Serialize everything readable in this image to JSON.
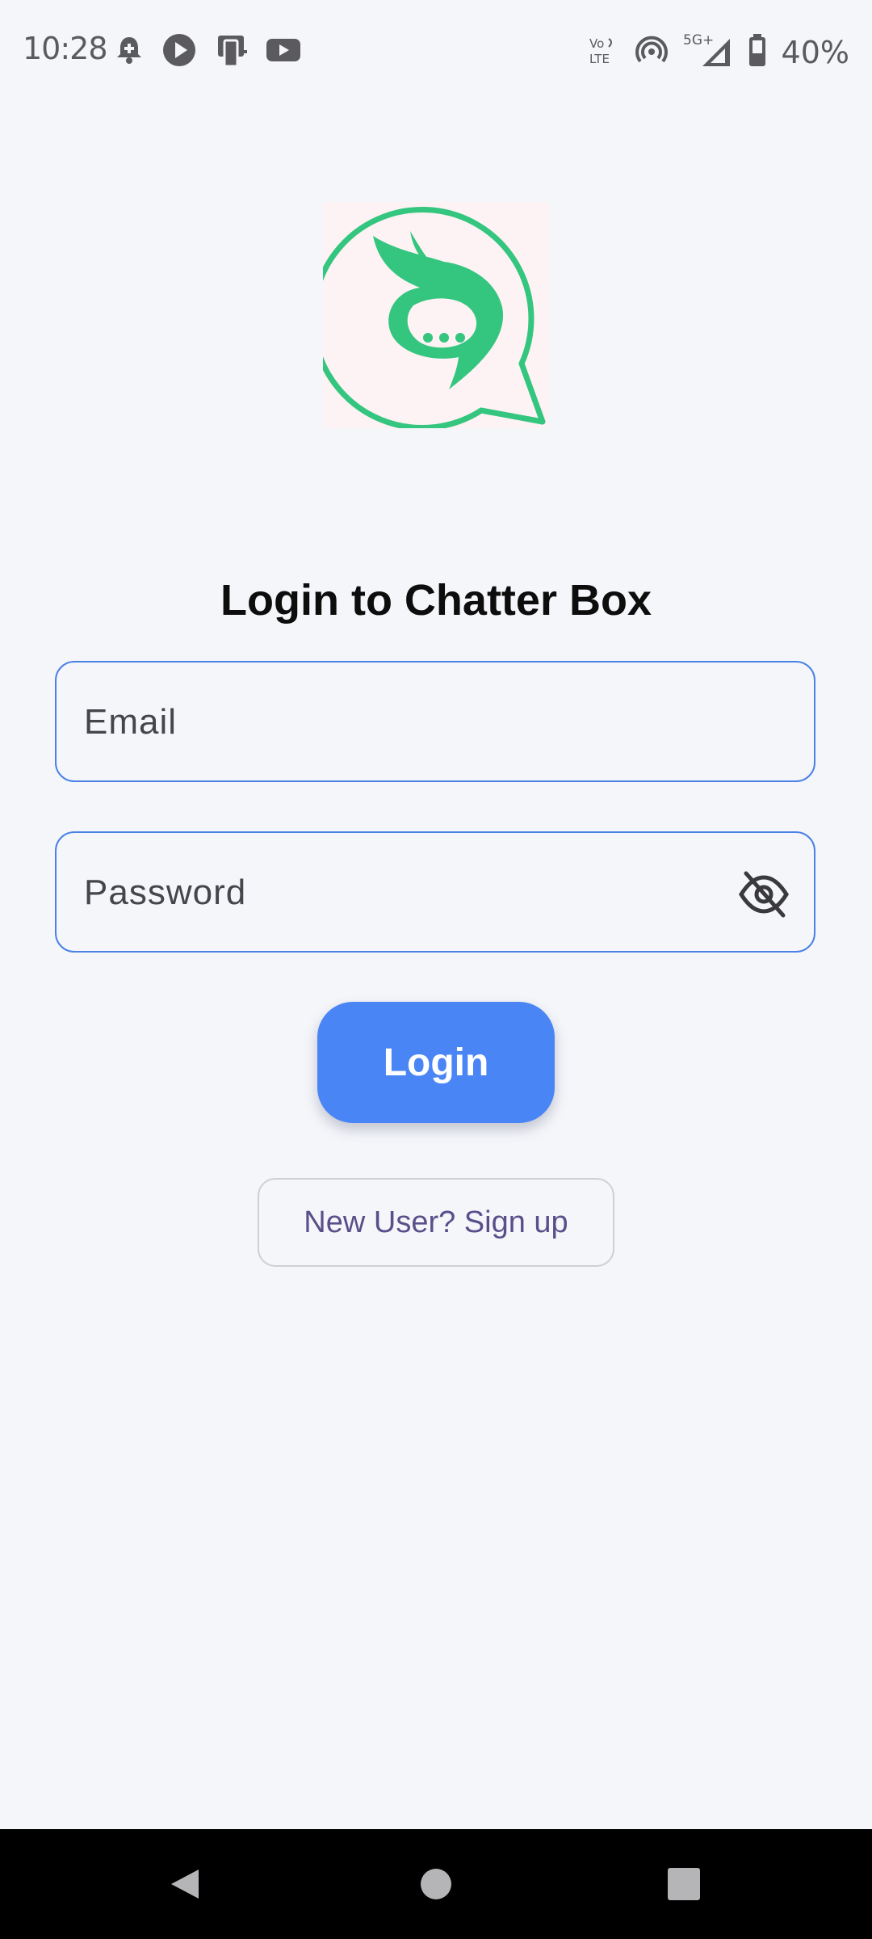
{
  "status_bar": {
    "time": "10:28",
    "battery": "40%",
    "network": "5G+",
    "left_icons": [
      "alarm-icon",
      "play-icon",
      "cast-icon",
      "youtube-icon"
    ],
    "right_icons": [
      "volte-icon",
      "hotspot-icon",
      "signal-icon",
      "battery-icon"
    ]
  },
  "app": {
    "logo": "chatter-box-logo",
    "brand_color": "#34c67f",
    "title": "Login to Chatter Box"
  },
  "form": {
    "email_placeholder": "Email",
    "email_value": "",
    "password_placeholder": "Password",
    "password_value": "",
    "visibility_icon": "eye-off-icon",
    "accent_color": "#4a82e6"
  },
  "actions": {
    "login_label": "Login",
    "login_color": "#4a85f6",
    "signup_label": "New User? Sign up"
  },
  "nav": {
    "back": "back-icon",
    "home": "home-icon",
    "recents": "recents-icon"
  }
}
